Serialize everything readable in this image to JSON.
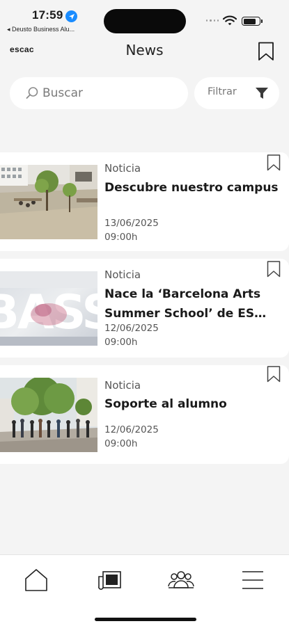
{
  "status_bar": {
    "time": "17:59",
    "back_app": "◂ Deusto Business Alu..."
  },
  "header": {
    "brand": "escac",
    "title": "News"
  },
  "search": {
    "placeholder": "Buscar",
    "value": ""
  },
  "filter": {
    "label": "Filtrar"
  },
  "news": [
    {
      "category": "Noticia",
      "title": "Descubre nuestro campus",
      "date": "13/06/2025",
      "time": "09:00h"
    },
    {
      "category": "Noticia",
      "title": "Nace la ‘Barcelona Arts Summer School’ de ES…",
      "date": "12/06/2025",
      "time": "09:00h"
    },
    {
      "category": "Noticia",
      "title": "Soporte al alumno",
      "date": "12/06/2025",
      "time": "09:00h"
    }
  ],
  "bottom_nav": [
    {
      "icon": "home-icon"
    },
    {
      "icon": "newspaper-icon"
    },
    {
      "icon": "community-icon"
    },
    {
      "icon": "menu-icon"
    }
  ],
  "colors": {
    "background": "#f4f4f4",
    "card": "#ffffff",
    "text": "#1a1a1a",
    "location_badge": "#1a8cff"
  }
}
